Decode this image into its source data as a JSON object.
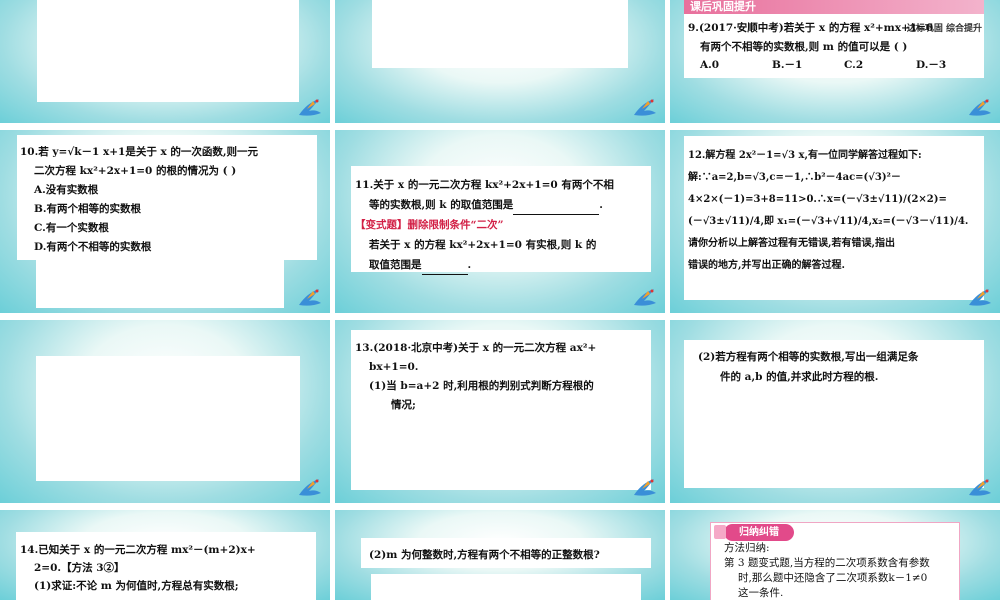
{
  "header": {
    "title": "课后巩固提升",
    "subtitle": "达标巩固 综合提升"
  },
  "q9": {
    "lines": [
      "9.(2017·安顺中考)若关于 x 的方程 x²+mx+1=0",
      "有两个不相等的实数根,则 m 的值可以是 (    )"
    ],
    "options": [
      "A.0",
      "B.－1",
      "C.2",
      "D.－3"
    ]
  },
  "q10": {
    "lines": [
      "10.若 y=√k－1 x+1是关于 x 的一次函数,则一元",
      "二次方程 kx²+2x+1=0 的根的情况为 (    )"
    ],
    "options": [
      "A.没有实数根",
      "B.有两个相等的实数根",
      "C.有一个实数根",
      "D.有两个不相等的实数根"
    ]
  },
  "q11": {
    "line1": "11.关于 x 的一元二次方程 kx²+2x+1=0 有两个不相",
    "line2": "等的实数根,则 k 的取值范围是",
    "variant_tag": "【变式题】删除限制条件“二次”",
    "line3": "若关于 x 的方程 kx²+2x+1=0 有实根,则 k 的",
    "line4": "取值范围是"
  },
  "q12": {
    "lines": [
      "12.解方程 2x²－1=√3 x,有一位同学解答过程如下:",
      "解:∵a=2,b=√3,c=－1,∴b²－4ac=(√3)²－",
      "4×2×(－1)=3+8=11>0.∴x=(－√3±√11)/(2×2)=",
      "(－√3±√11)/4,即 x₁=(－√3+√11)/4,x₂=(－√3－√11)/4.",
      "请你分析以上解答过程有无错误,若有错误,指出",
      "错误的地方,并写出正确的解答过程."
    ]
  },
  "q13": {
    "lines": [
      "13.(2018·北京中考)关于 x 的一元二次方程 ax²+",
      "bx+1=0.",
      "(1)当 b=a+2 时,利用根的判别式判断方程根的",
      "情况;"
    ]
  },
  "q13b": {
    "lines": [
      "(2)若方程有两个相等的实数根,写出一组满足条",
      "件的 a,b 的值,并求此时方程的根."
    ]
  },
  "q14": {
    "lines": [
      "14.已知关于 x 的一元二次方程 mx²－(m+2)x+",
      "2=0.【方法 3②】",
      "(1)求证:不论 m 为何值时,方程总有实数根;"
    ]
  },
  "q14b": {
    "lines": [
      "(2)m 为何整数时,方程有两个不相等的正整数根?"
    ]
  },
  "summary": {
    "badge": "归纳纠错",
    "lines": [
      "方法归纳:",
      "第 3 题变式题,当方程的二次项系数含有参数",
      "时,那么题中还隐含了二次项系数k－1≠0",
      "这一条件."
    ]
  }
}
